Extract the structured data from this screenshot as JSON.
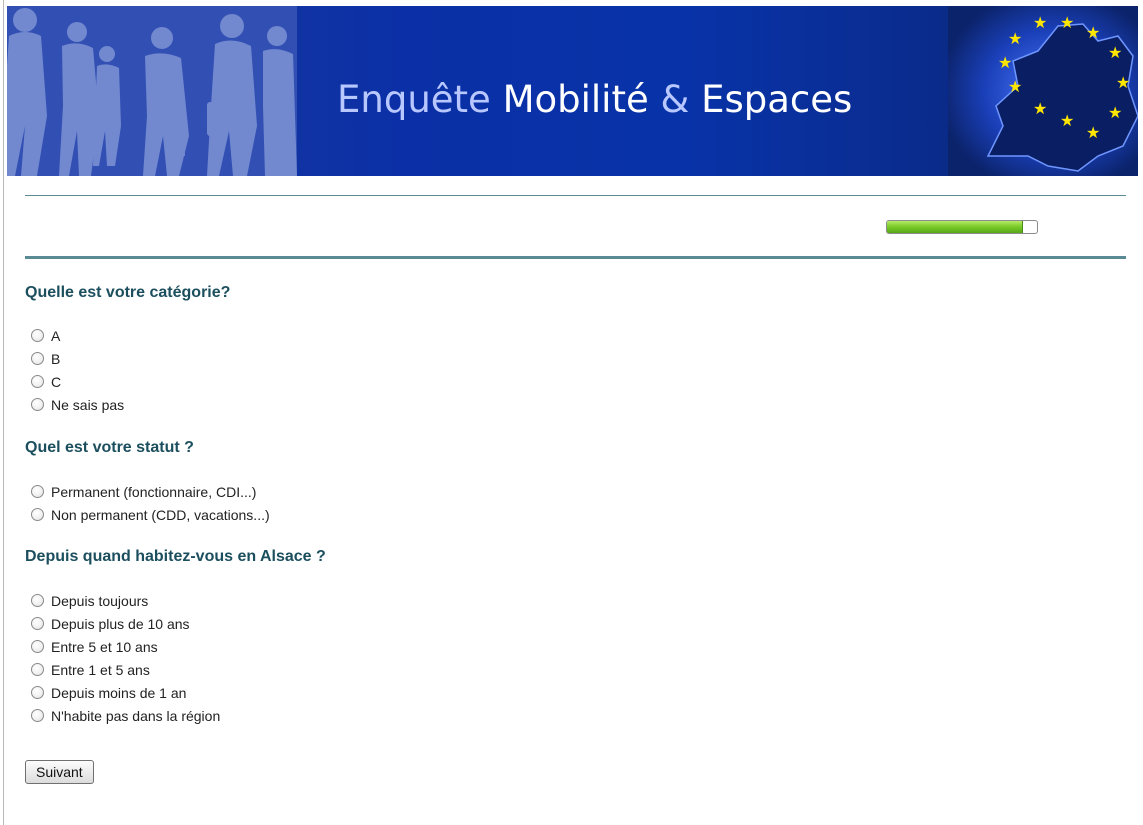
{
  "banner": {
    "title_part1": "Enquête",
    "title_part2": " Mobilité ",
    "title_part3": "&",
    "title_part4": " Espaces"
  },
  "progress": {
    "value_fraction": 0.9
  },
  "questions": [
    {
      "title": "Quelle est votre catégorie?",
      "options": [
        "A",
        "B",
        "C",
        "Ne sais pas"
      ]
    },
    {
      "title": "Quel est votre statut ?",
      "options": [
        "Permanent (fonctionnaire, CDI...)",
        "Non permanent (CDD, vacations...)"
      ]
    },
    {
      "title": "Depuis quand habitez-vous en Alsace ?",
      "options": [
        "Depuis toujours",
        "Depuis plus de 10 ans",
        "Entre 5 et 10 ans",
        "Entre 1 et 5 ans",
        "Depuis moins de 1 an",
        "N'habite pas dans la région"
      ]
    }
  ],
  "next_button": {
    "label": "Suivant"
  },
  "colors": {
    "accent": "#1c4f5e",
    "banner": "#0b2fa6",
    "progress": "#7dcc2b"
  }
}
